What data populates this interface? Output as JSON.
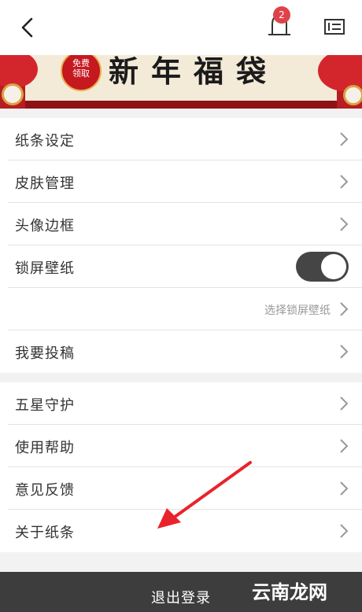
{
  "topbar": {
    "back_icon": "chevron-left-icon",
    "bell_icon": "bell-icon",
    "notification_count": "2",
    "card_icon": "id-card-icon"
  },
  "banner": {
    "stamp_line1": "免费",
    "stamp_line2": "领取",
    "title": "新年福袋"
  },
  "settings_group_1": [
    {
      "label": "纸条设定"
    },
    {
      "label": "皮肤管理"
    },
    {
      "label": "头像边框"
    },
    {
      "label": "锁屏壁纸",
      "toggle_on": true
    },
    {
      "label": "选择锁屏壁纸"
    },
    {
      "label": "我要投稿"
    }
  ],
  "settings_group_2": [
    {
      "label": "五星守护"
    },
    {
      "label": "使用帮助"
    },
    {
      "label": "意见反馈"
    },
    {
      "label": "关于纸条"
    }
  ],
  "logout": {
    "label": "退出登录"
  },
  "watermark": {
    "text": "云南龙网"
  },
  "colors": {
    "accent_red": "#e0424a",
    "toggle_on": "#454545",
    "logout_bg": "#3d3d3d",
    "annotation_arrow": "#e8242a"
  }
}
